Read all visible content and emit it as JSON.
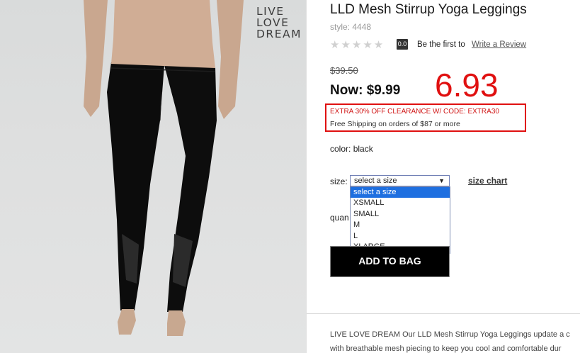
{
  "image": {
    "logo_lines": [
      "LIVE",
      "LOVE",
      "DREAM"
    ]
  },
  "product": {
    "title": "LLD Mesh Stirrup Yoga Leggings",
    "style": "style: 4448",
    "rating_value": "0.0",
    "first_review_text": "Be the first to",
    "write_review_label": "Write a Review",
    "old_price": "$39.50",
    "now_price": "Now: $9.99",
    "annotation": "6.93",
    "promo_text": "EXTRA 30% OFF CLEARANCE W/ CODE: EXTRA30",
    "shipping_text": "Free Shipping on orders of $87 or more",
    "color_label": "color:",
    "color_value": "black",
    "size_label": "size:",
    "size_selected": "select a size",
    "size_options": [
      "select a size",
      "XSMALL",
      "SMALL",
      "M",
      "L",
      "XLARGE"
    ],
    "size_chart_label": "size chart",
    "quantity_label": "quan",
    "add_to_bag_label": "ADD TO BAG",
    "description_line1": "LIVE LOVE DREAM Our LLD Mesh Stirrup Yoga Leggings update a c",
    "description_line2": "with breathable mesh piecing to keep you cool and comfortable dur"
  },
  "colors": {
    "annotation_red": "#e01010",
    "dropdown_selected": "#1e6fe0",
    "button_bg": "#000000"
  }
}
